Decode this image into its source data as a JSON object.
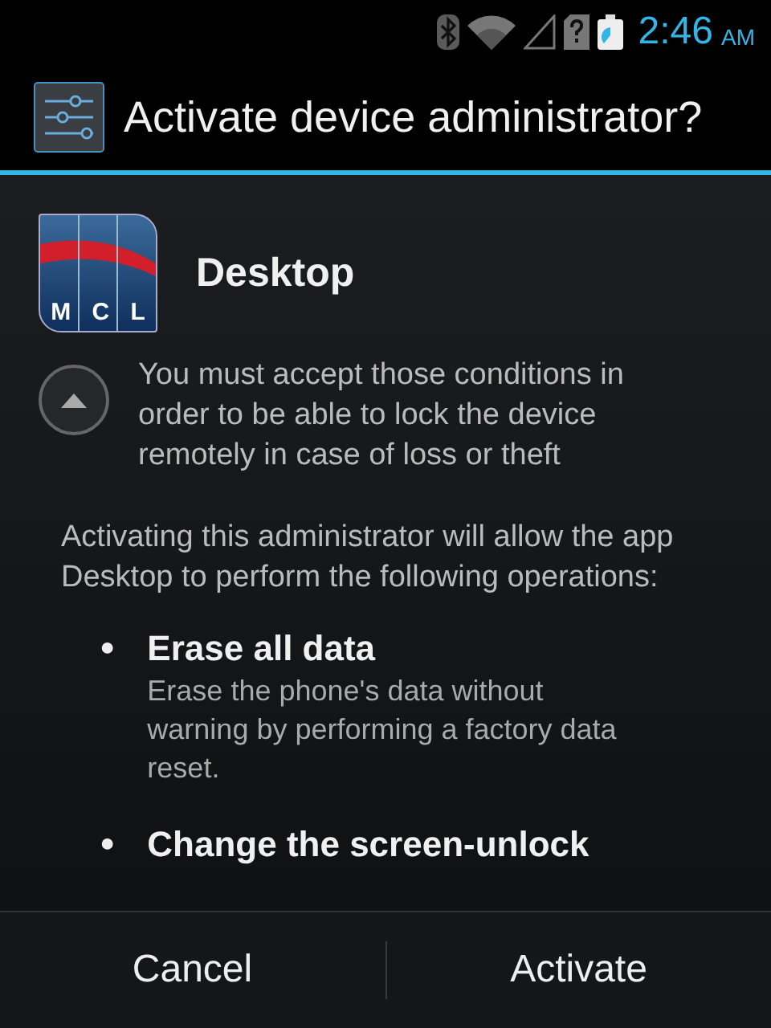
{
  "status_bar": {
    "time": "2:46",
    "ampm": "AM"
  },
  "dialog": {
    "title": "Activate device administrator?"
  },
  "app": {
    "logo_letters": [
      "M",
      "C",
      "L"
    ],
    "name": "Desktop"
  },
  "description": {
    "expanded": true,
    "text": "You must accept those conditions in order to be able to lock the device remotely in case of loss or theft"
  },
  "intro": "Activating this administrator will allow the app Desktop to perform the following operations:",
  "operations": [
    {
      "bullet": "●",
      "title": "Erase all data",
      "detail": "Erase the phone's data without warning by performing a factory data reset."
    },
    {
      "bullet": "●",
      "title": "Change the screen-unlock"
    }
  ],
  "buttons": [
    "Cancel",
    "Activate"
  ]
}
